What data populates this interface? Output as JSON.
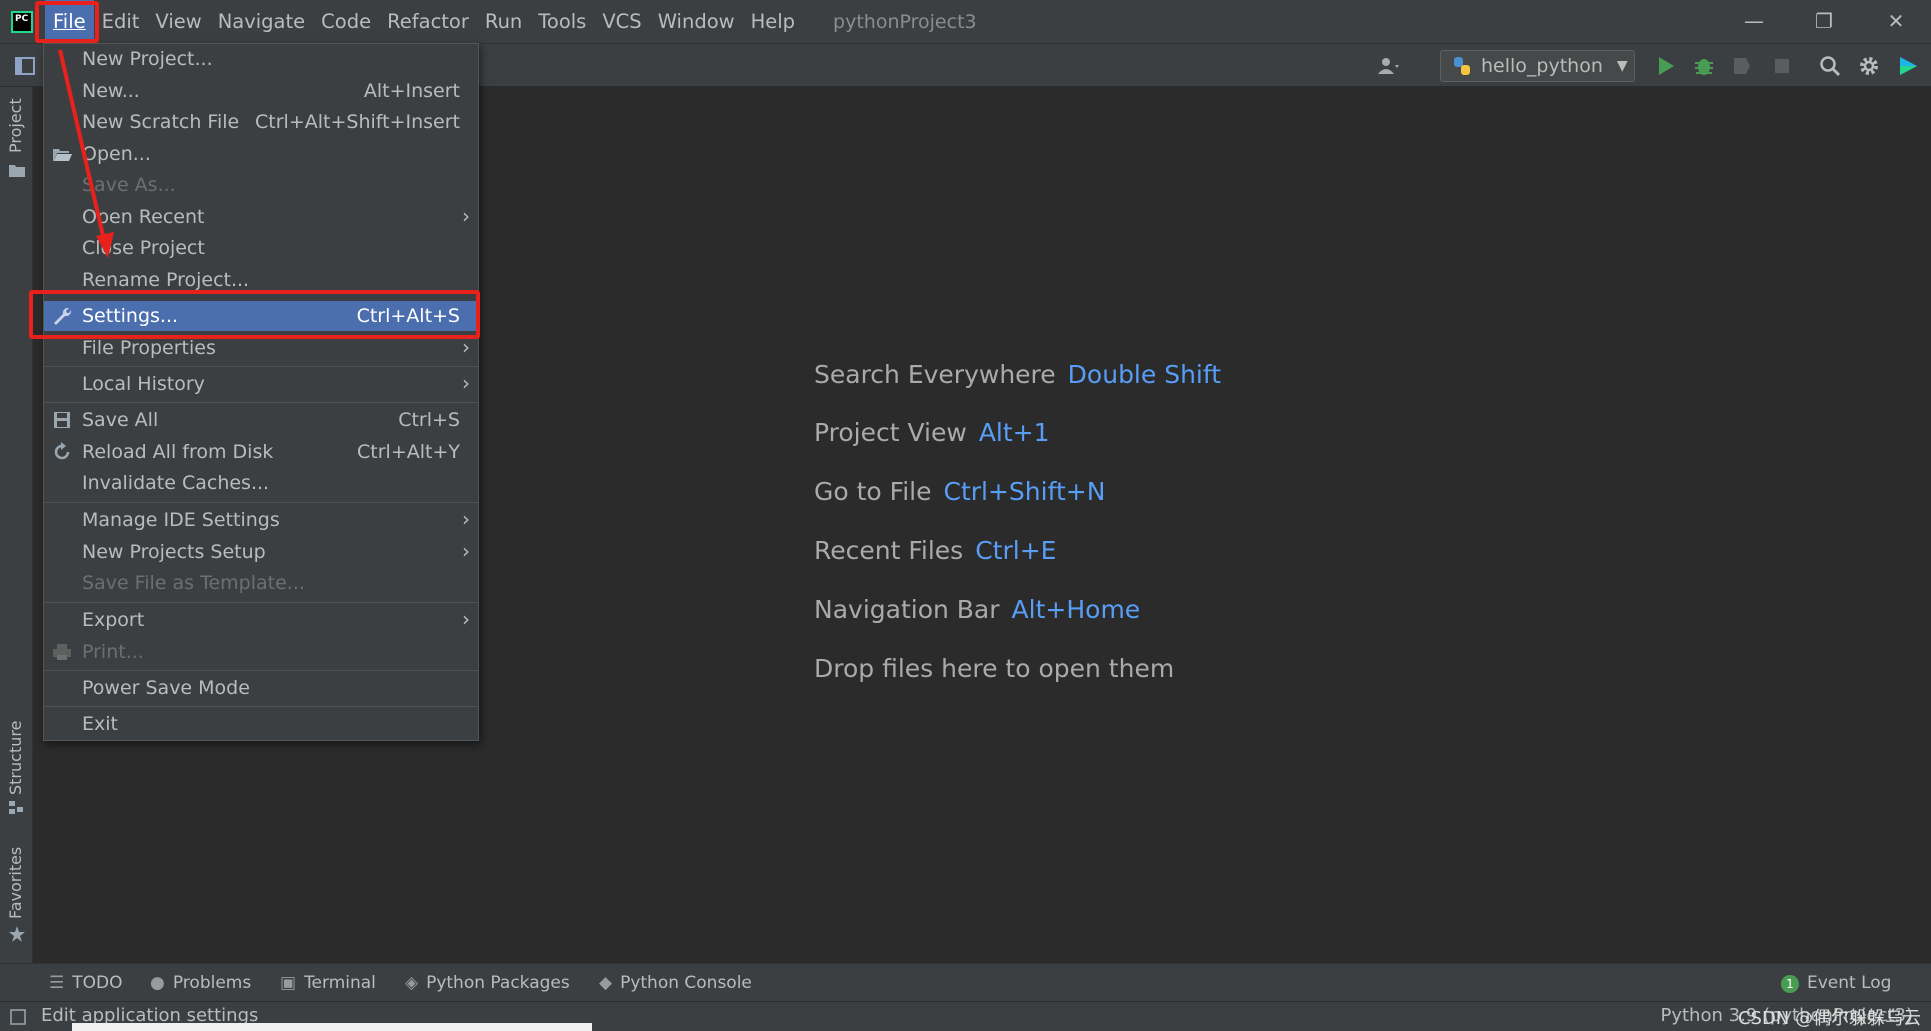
{
  "app": {
    "logo": "PC",
    "project_title": "pythonProject3"
  },
  "menubar": {
    "items": [
      "File",
      "Edit",
      "View",
      "Navigate",
      "Code",
      "Refactor",
      "Run",
      "Tools",
      "VCS",
      "Window",
      "Help"
    ]
  },
  "toolbar": {
    "run_config": "hello_python"
  },
  "side_tabs": {
    "project": "Project",
    "structure": "Structure",
    "favorites": "Favorites"
  },
  "file_menu": {
    "items": [
      {
        "label": "New Project...",
        "shortcut": ""
      },
      {
        "label": "New...",
        "shortcut": "Alt+Insert"
      },
      {
        "label": "New Scratch File",
        "shortcut": "Ctrl+Alt+Shift+Insert"
      },
      {
        "label": "Open...",
        "shortcut": ""
      },
      {
        "label": "Save As...",
        "shortcut": ""
      },
      {
        "label": "Open Recent",
        "shortcut": ""
      },
      {
        "label": "Close Project",
        "shortcut": ""
      },
      {
        "label": "Rename Project...",
        "shortcut": ""
      },
      {
        "label": "Settings...",
        "shortcut": "Ctrl+Alt+S"
      },
      {
        "label": "File Properties",
        "shortcut": ""
      },
      {
        "label": "Local History",
        "shortcut": ""
      },
      {
        "label": "Save All",
        "shortcut": "Ctrl+S"
      },
      {
        "label": "Reload All from Disk",
        "shortcut": "Ctrl+Alt+Y"
      },
      {
        "label": "Invalidate Caches...",
        "shortcut": ""
      },
      {
        "label": "Manage IDE Settings",
        "shortcut": ""
      },
      {
        "label": "New Projects Setup",
        "shortcut": ""
      },
      {
        "label": "Save File as Template...",
        "shortcut": ""
      },
      {
        "label": "Export",
        "shortcut": ""
      },
      {
        "label": "Print...",
        "shortcut": ""
      },
      {
        "label": "Power Save Mode",
        "shortcut": ""
      },
      {
        "label": "Exit",
        "shortcut": ""
      }
    ]
  },
  "editor_hints": [
    {
      "label": "Search Everywhere",
      "shortcut": "Double Shift"
    },
    {
      "label": "Project View",
      "shortcut": "Alt+1"
    },
    {
      "label": "Go to File",
      "shortcut": "Ctrl+Shift+N"
    },
    {
      "label": "Recent Files",
      "shortcut": "Ctrl+E"
    },
    {
      "label": "Navigation Bar",
      "shortcut": "Alt+Home"
    },
    {
      "label": "Drop files here to open them",
      "shortcut": ""
    }
  ],
  "bottom_tools": {
    "todo": "TODO",
    "problems": "Problems",
    "terminal": "Terminal",
    "python_packages": "Python Packages",
    "python_console": "Python Console",
    "event_log_count": "1",
    "event_log": "Event Log"
  },
  "status_bar": {
    "message": "Edit application settings",
    "interpreter": "Python 3.9 (pythonProject3)",
    "watermark": "CSDN @偶尔躲躲乌云"
  },
  "colors": {
    "accent": "#4b6eaf",
    "shortcut_blue": "#589df6",
    "highlight_red": "#e8211d",
    "run_green": "#499c54"
  }
}
